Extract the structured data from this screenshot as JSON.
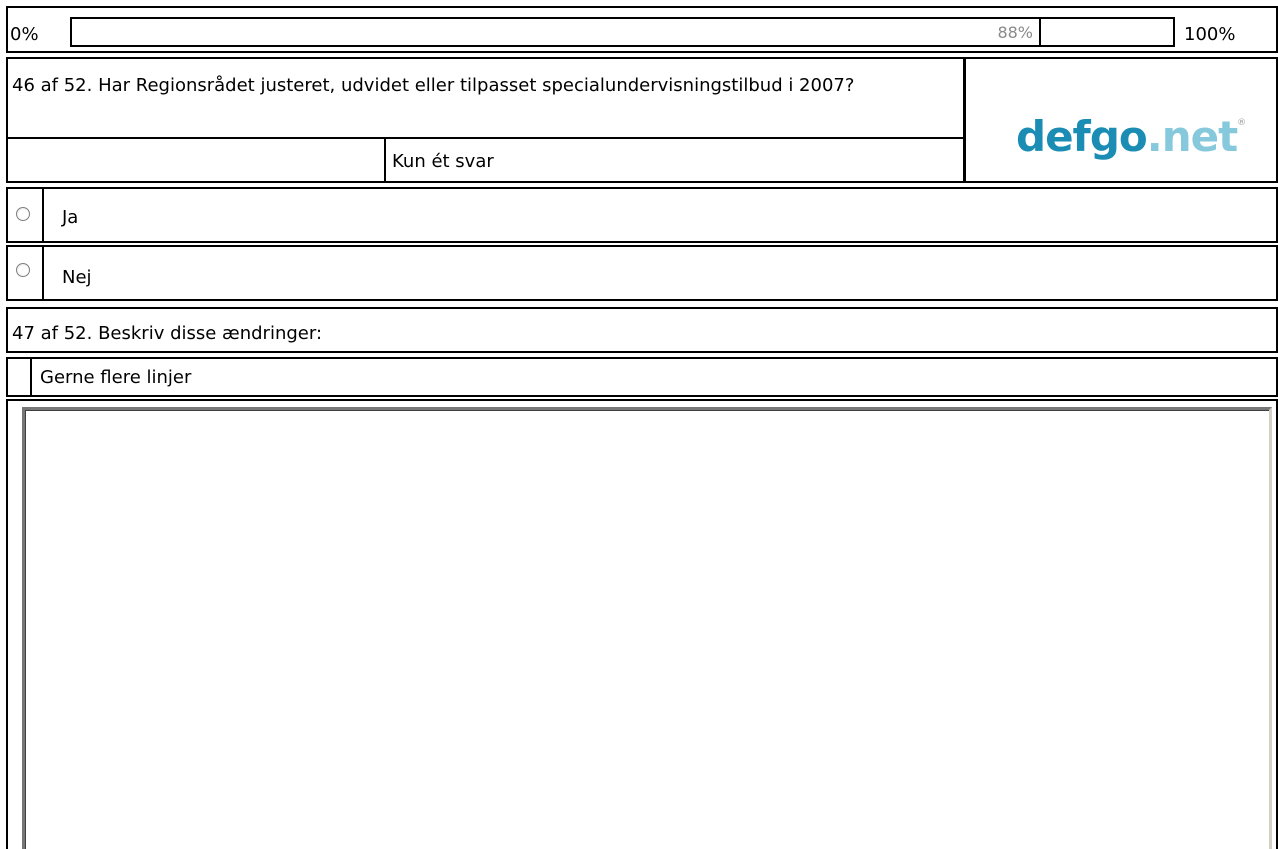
{
  "progress": {
    "min_label": "0%",
    "max_label": "100%",
    "value_label": "88%",
    "value": 88
  },
  "question46": {
    "text": "46 af 52. Har Regionsrådet justeret, udvidet eller tilpasset specialundervisningstilbud i 2007?",
    "hint": "Kun ét svar",
    "options": [
      {
        "label": "Ja"
      },
      {
        "label": "Nej"
      }
    ]
  },
  "logo": {
    "part1": "defgo",
    "part2": ".net",
    "reg": "®",
    "colors": {
      "primary": "#1b8db4",
      "secondary": "#86c8dc"
    }
  },
  "question47": {
    "text": "47 af 52. Beskriv disse ændringer:",
    "hint": "Gerne flere linjer",
    "answer_value": ""
  }
}
